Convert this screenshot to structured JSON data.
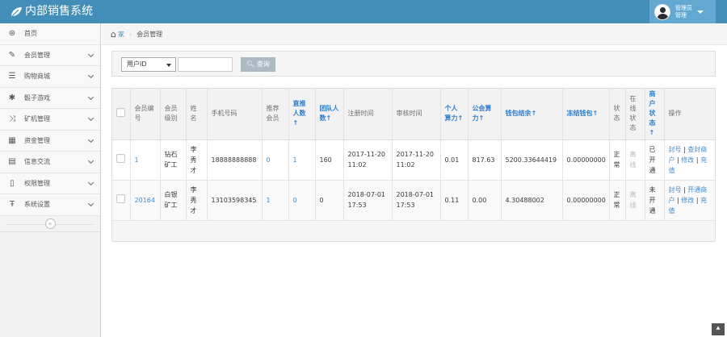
{
  "header": {
    "brand": "内部销售系统",
    "user_line1": "管理员",
    "user_line2": "管理"
  },
  "sidebar": {
    "items": [
      {
        "label": "首页",
        "icon": "dashboard-icon",
        "glyph": "⊛",
        "has_chevron": false
      },
      {
        "label": "会员管理",
        "icon": "edit-icon",
        "glyph": "✎",
        "has_chevron": true
      },
      {
        "label": "购物商城",
        "icon": "list-icon",
        "glyph": "☰",
        "has_chevron": true
      },
      {
        "label": "骰子游戏",
        "icon": "asterisk-icon",
        "glyph": "✱",
        "has_chevron": true
      },
      {
        "label": "矿机管理",
        "icon": "random-icon",
        "glyph": "⤨",
        "has_chevron": true
      },
      {
        "label": "资金管理",
        "icon": "calendar-icon",
        "glyph": "▦",
        "has_chevron": true
      },
      {
        "label": "信息交流",
        "icon": "list-alt-icon",
        "glyph": "▤",
        "has_chevron": true
      },
      {
        "label": "权限管理",
        "icon": "file-icon",
        "glyph": "▯",
        "has_chevron": true
      },
      {
        "label": "系统设置",
        "icon": "text-width-icon",
        "glyph": "Ŧ",
        "has_chevron": true
      }
    ],
    "collapse_glyph": "«"
  },
  "breadcrumb": {
    "home": "家",
    "separator": "›",
    "current": "会员管理"
  },
  "search": {
    "field_select": "用户ID",
    "input_value": "",
    "button": "查询"
  },
  "table": {
    "headers": [
      {
        "text": "",
        "sortable": false
      },
      {
        "text": "会员编号",
        "sortable": false
      },
      {
        "text": "会员级别",
        "sortable": false
      },
      {
        "text": "姓名",
        "sortable": false
      },
      {
        "text": "手机号码",
        "sortable": false
      },
      {
        "text": "推荐会员",
        "sortable": false
      },
      {
        "text": "直推人数↑",
        "sortable": true
      },
      {
        "text": "团队人数↑",
        "sortable": true
      },
      {
        "text": "注册时间",
        "sortable": false
      },
      {
        "text": "审核时间",
        "sortable": false
      },
      {
        "text": "个人算力↑",
        "sortable": true
      },
      {
        "text": "公会算力↑",
        "sortable": true
      },
      {
        "text": "钱包结余↑",
        "sortable": true
      },
      {
        "text": "冻结钱包↑",
        "sortable": true
      },
      {
        "text": "状态",
        "sortable": false
      },
      {
        "text": "在线状态",
        "sortable": false
      },
      {
        "text": "商户状态↑",
        "sortable": true
      },
      {
        "text": "操作",
        "sortable": false
      }
    ],
    "rows": [
      {
        "id": "1",
        "level": "钻石矿工",
        "name": "李秀才",
        "phone": "18888888888",
        "referrer": "0",
        "direct": "1",
        "team": "160",
        "registered": "2017-11-20 11:02",
        "reviewed": "2017-11-20 11:02",
        "personal_power": "0.01",
        "guild_power": "817.63",
        "wallet": "5200.33644419",
        "frozen": "0.00000000",
        "status": "正常",
        "online": "离线",
        "merchant": "已开通",
        "ops": [
          "封号",
          "查封商户",
          "修改",
          "充值"
        ]
      },
      {
        "id": "20164",
        "level": "白银矿工",
        "name": "李秀才",
        "phone": "13103598345",
        "referrer": "1",
        "direct": "0",
        "team": "0",
        "registered": "2018-07-01 17:53",
        "reviewed": "2018-07-01 17:53",
        "personal_power": "0.11",
        "guild_power": "0.00",
        "wallet": "4.30488002",
        "frozen": "0.00000000",
        "status": "正常",
        "online": "离线",
        "merchant": "未开通",
        "ops": [
          "封号",
          "开通商户",
          "修改",
          "充值"
        ]
      }
    ]
  },
  "colors": {
    "navbar": "#438eb9",
    "link": "#428bca",
    "sort_header": "#307ecc"
  }
}
